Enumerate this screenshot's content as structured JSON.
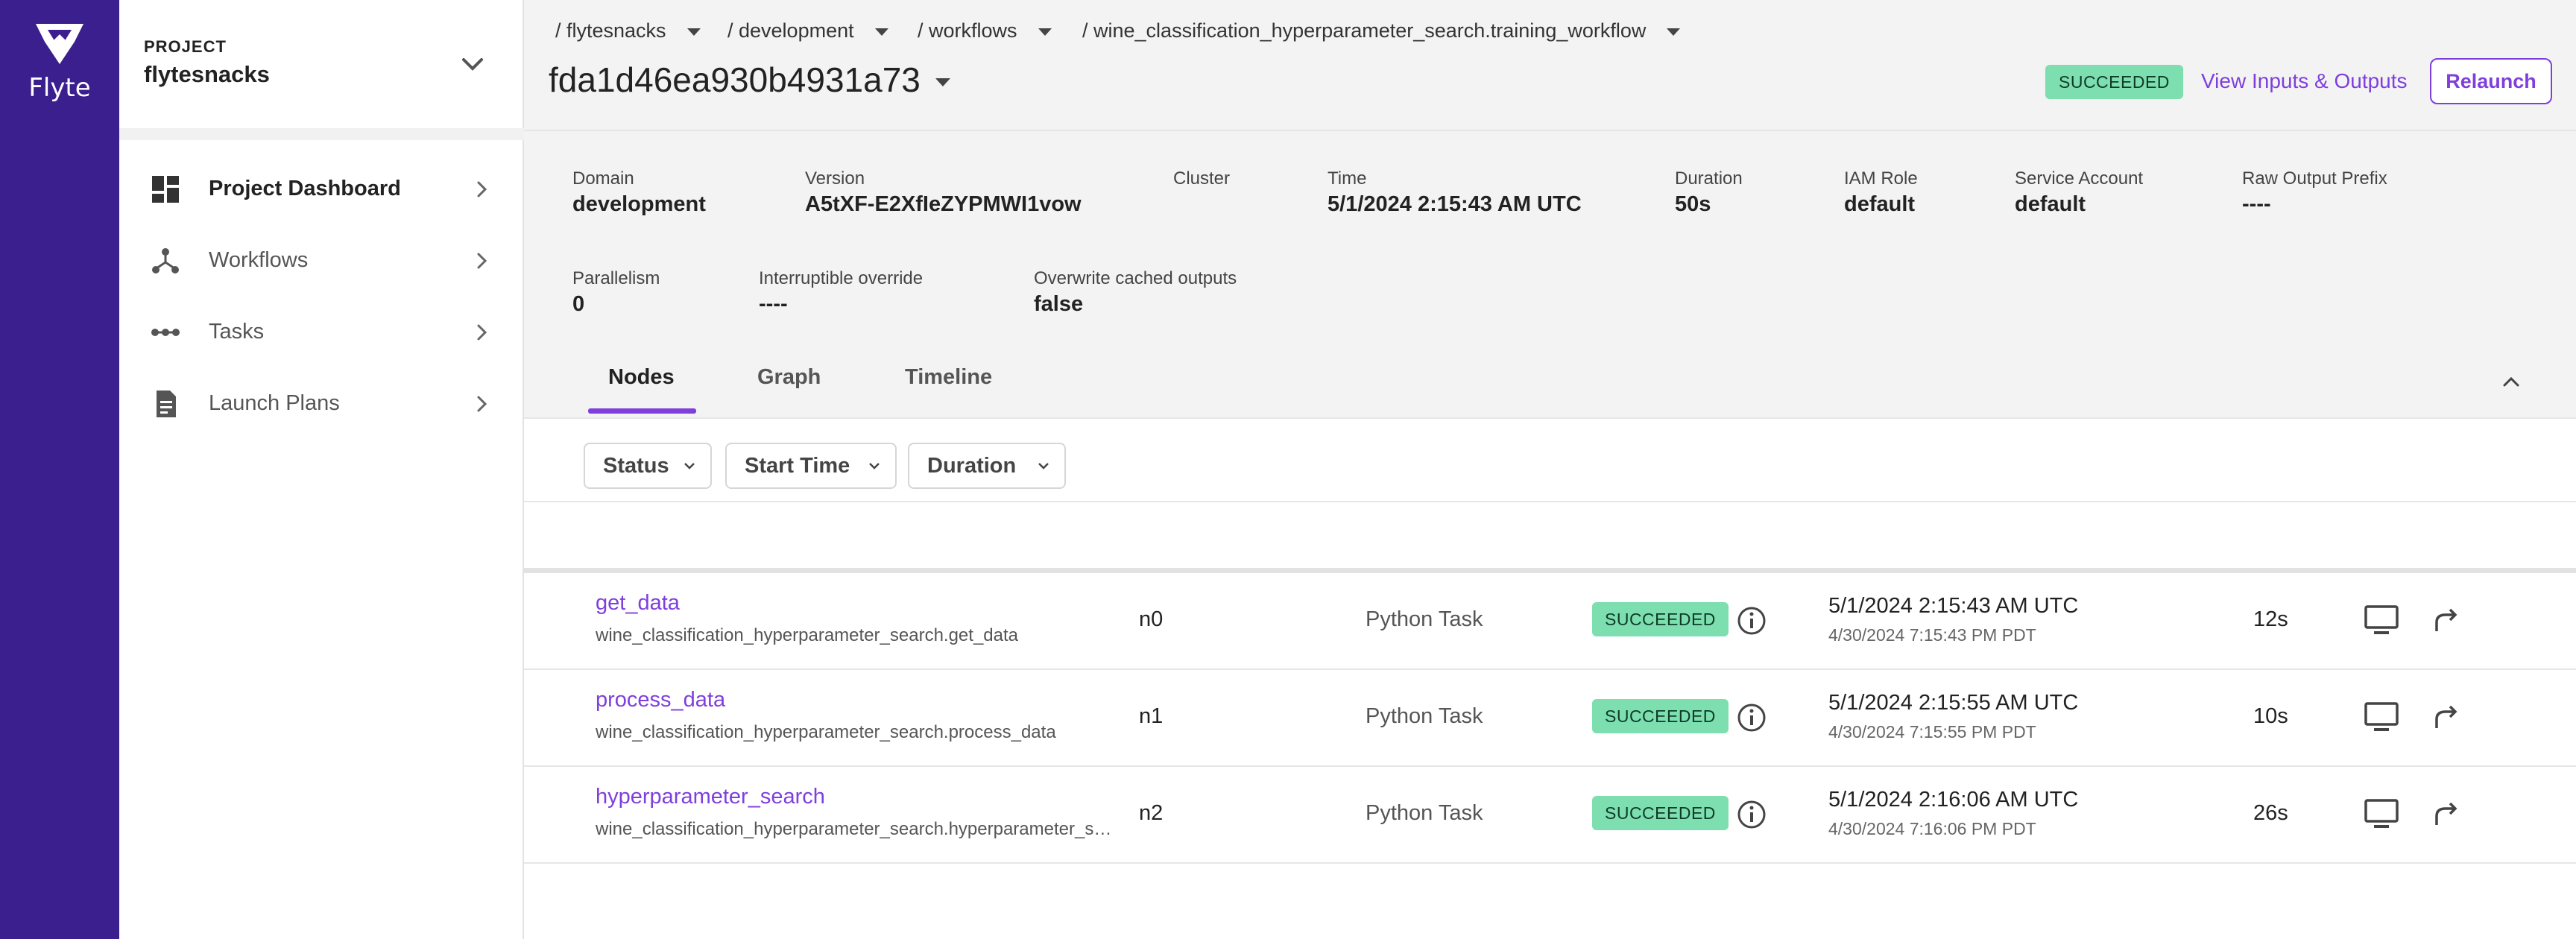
{
  "brand": {
    "name": "Flyte"
  },
  "project": {
    "label": "PROJECT",
    "name": "flytesnacks"
  },
  "nav": [
    {
      "label": "Project Dashboard",
      "icon": "dashboard-icon",
      "active": true
    },
    {
      "label": "Workflows",
      "icon": "workflow-icon",
      "active": false
    },
    {
      "label": "Tasks",
      "icon": "tasks-icon",
      "active": false
    },
    {
      "label": "Launch Plans",
      "icon": "launch-plan-icon",
      "active": false
    }
  ],
  "breadcrumb": [
    "/ flytesnacks",
    "/ development",
    "/ workflows",
    "/ wine_classification_hyperparameter_search.training_workflow"
  ],
  "execution": {
    "id": "fda1d46ea930b4931a73",
    "status": "SUCCEEDED",
    "view_io_label": "View Inputs & Outputs",
    "relaunch_label": "Relaunch"
  },
  "meta": [
    {
      "key": "Domain",
      "value": "development"
    },
    {
      "key": "Version",
      "value": "A5tXF-E2XfIeZYPMWI1vow"
    },
    {
      "key": "Cluster",
      "value": ""
    },
    {
      "key": "Time",
      "value": "5/1/2024 2:15:43 AM UTC"
    },
    {
      "key": "Duration",
      "value": "50s"
    },
    {
      "key": "IAM Role",
      "value": "default"
    },
    {
      "key": "Service Account",
      "value": "default"
    },
    {
      "key": "Raw Output Prefix",
      "value": "----"
    },
    {
      "key": "Parallelism",
      "value": "0"
    },
    {
      "key": "Interruptible override",
      "value": "----"
    },
    {
      "key": "Overwrite cached outputs",
      "value": "false"
    }
  ],
  "tabs": [
    "Nodes",
    "Graph",
    "Timeline"
  ],
  "filters": [
    "Status",
    "Start Time",
    "Duration"
  ],
  "nodes": [
    {
      "name": "get_data",
      "full_name": "wine_classification_hyperparameter_search.get_data",
      "id": "n0",
      "type": "Python Task",
      "status": "SUCCEEDED",
      "start_utc": "5/1/2024 2:15:43 AM UTC",
      "start_local": "4/30/2024 7:15:43 PM PDT",
      "duration": "12s"
    },
    {
      "name": "process_data",
      "full_name": "wine_classification_hyperparameter_search.process_data",
      "id": "n1",
      "type": "Python Task",
      "status": "SUCCEEDED",
      "start_utc": "5/1/2024 2:15:55 AM UTC",
      "start_local": "4/30/2024 7:15:55 PM PDT",
      "duration": "10s"
    },
    {
      "name": "hyperparameter_search",
      "full_name": "wine_classification_hyperparameter_search.hyperparameter_search",
      "id": "n2",
      "type": "Python Task",
      "status": "SUCCEEDED",
      "start_utc": "5/1/2024 2:16:06 AM UTC",
      "start_local": "4/30/2024 7:16:06 PM PDT",
      "duration": "26s"
    }
  ],
  "colors": {
    "rail": "#3b1f8f",
    "accent": "#7e3fdd",
    "success": "#7ddeb0"
  }
}
